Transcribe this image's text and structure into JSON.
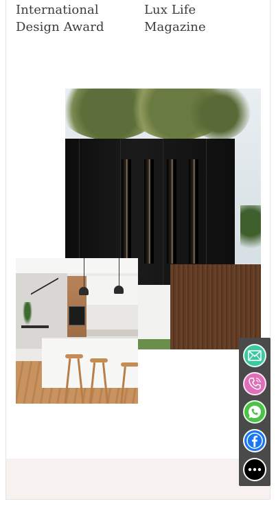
{
  "awards": [
    {
      "line1": "International",
      "line2": "Design Award"
    },
    {
      "line1": "Lux Life",
      "line2": "Magazine"
    }
  ],
  "contact_bar": {
    "buttons": [
      {
        "icon": "email-icon",
        "color": "#3ec7a1"
      },
      {
        "icon": "phone-icon",
        "color": "#e06fb9"
      },
      {
        "icon": "whatsapp-icon",
        "color": "#4cc247"
      },
      {
        "icon": "facebook-icon",
        "color": "#1877f2"
      },
      {
        "icon": "more-icon",
        "color": "#000000"
      }
    ]
  },
  "colors": {
    "footer_band": "#f7f2ef",
    "contact_bar_bg": "#4a4a4a"
  }
}
